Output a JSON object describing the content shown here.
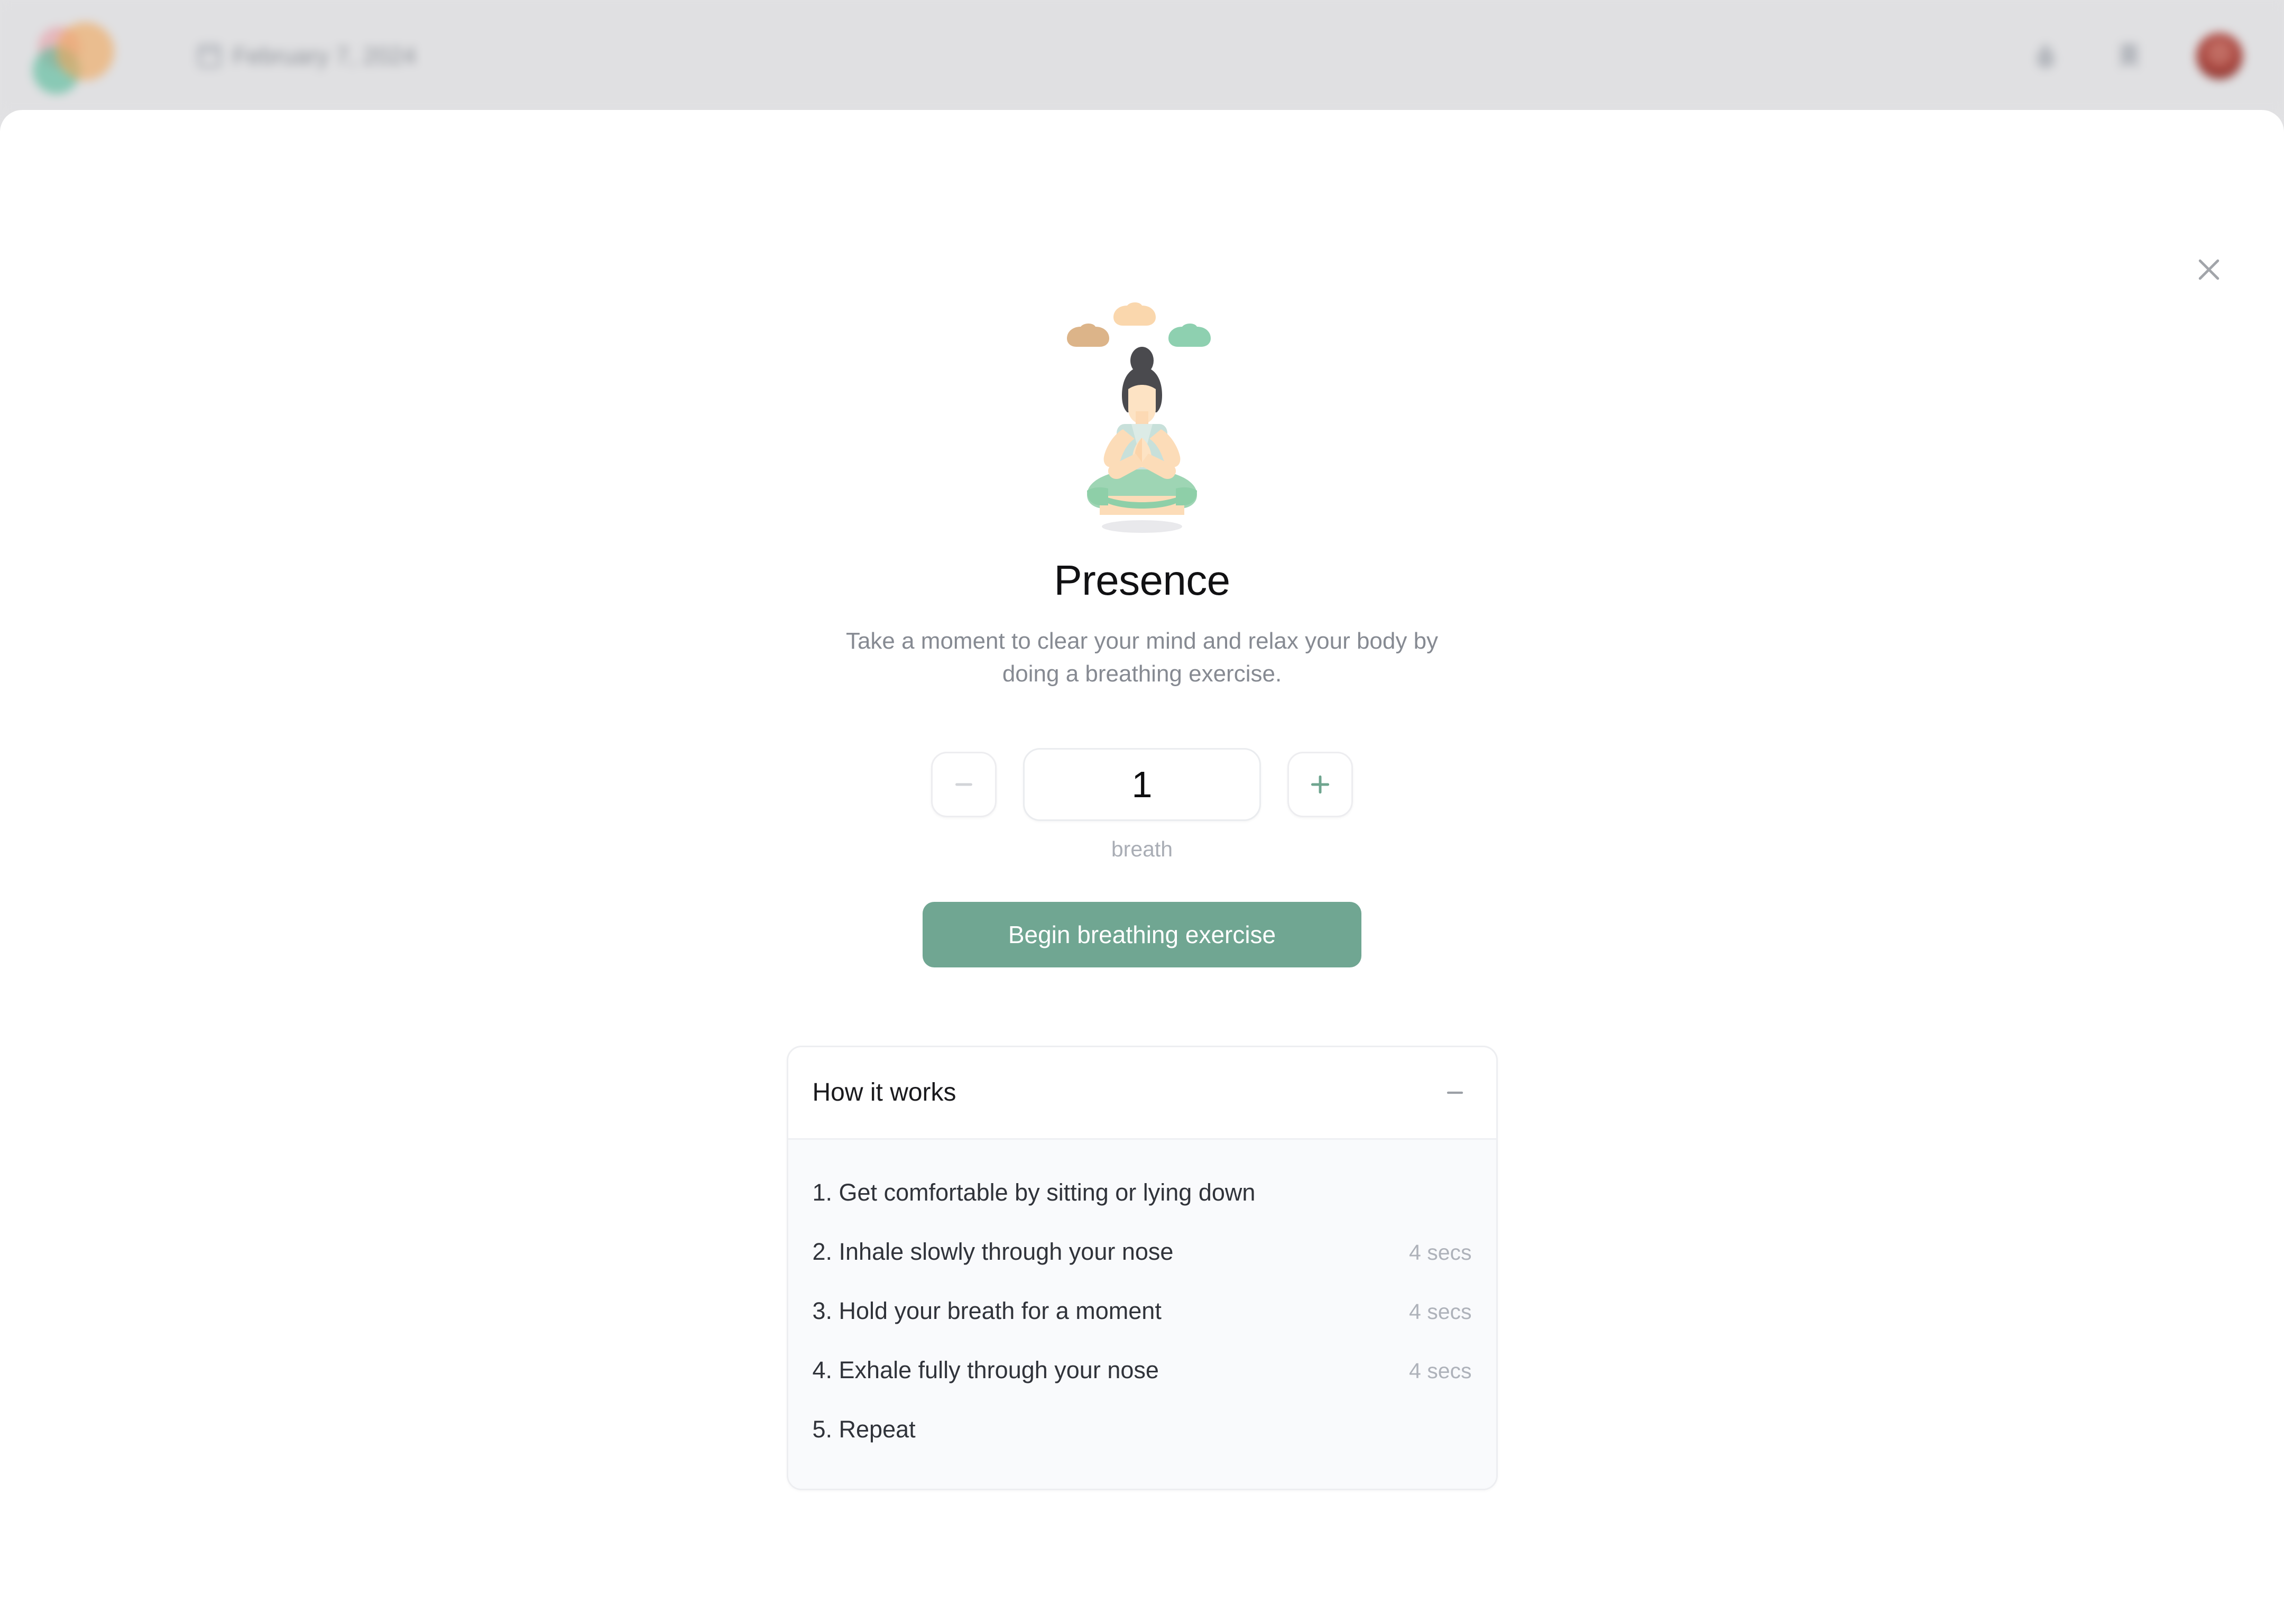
{
  "header": {
    "logo_name": "app-logo",
    "logo_colors": [
      "#e8a0a8",
      "#54bb9a",
      "#f0a85c"
    ],
    "date_label": "February 7, 2024",
    "calendar_icon": "calendar-icon",
    "actions": [
      {
        "icon": "water-drop-icon",
        "name": "hydration-button"
      },
      {
        "icon": "bookmark-icon",
        "name": "bookmark-button"
      }
    ],
    "avatar_name": "user-avatar"
  },
  "modal": {
    "close_label": "✕",
    "close_icon": "close-icon",
    "illustration_name": "meditation-illustration",
    "title": "Presence",
    "description": "Take a moment to clear your mind and relax your body by doing a breathing exercise.",
    "stepper": {
      "decrement_label": "−",
      "decrement_icon": "minus-icon",
      "increment_label": "+",
      "increment_icon": "plus-icon",
      "value": "1",
      "unit": "breath",
      "decrement_disabled": true
    },
    "cta_label": "Begin breathing exercise",
    "how_it_works": {
      "title": "How it works",
      "collapse_icon": "minus-icon",
      "expanded": true,
      "steps": [
        {
          "text": "1. Get comfortable by sitting or lying down",
          "duration": ""
        },
        {
          "text": "2. Inhale slowly through your nose",
          "duration": "4 secs"
        },
        {
          "text": "3. Hold your breath for a moment",
          "duration": "4 secs"
        },
        {
          "text": "4. Exhale fully through your nose",
          "duration": "4 secs"
        },
        {
          "text": "5. Repeat",
          "duration": ""
        }
      ]
    }
  },
  "colors": {
    "accent": "#70a692",
    "header_bg": "#e0e0e2",
    "sheet_bg": "#ffffff",
    "card_body_bg": "#f9fafc",
    "muted_text": "#a9adb5"
  }
}
